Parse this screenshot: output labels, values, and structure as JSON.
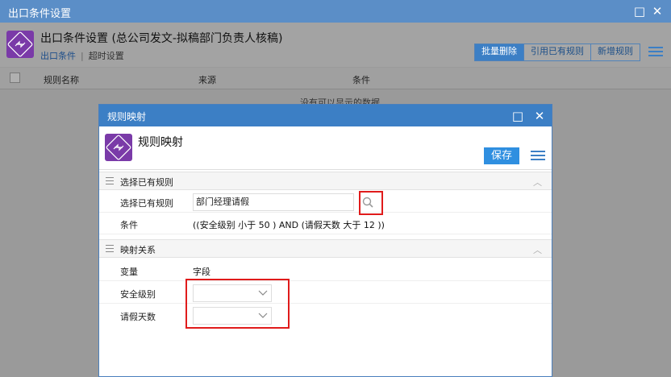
{
  "outer": {
    "title": "出口条件设置",
    "heading": "出口条件设置 (总公司发文-拟稿部门负责人核稿)",
    "tabs": [
      "出口条件",
      "超时设置"
    ],
    "buttons": [
      "批量删除",
      "引用已有规则",
      "新增规则"
    ],
    "columns": [
      "规则名称",
      "来源",
      "条件"
    ],
    "empty_text": "没有可以显示的数据",
    "icons": [
      "maximize-icon",
      "close-icon",
      "list-menu-icon",
      "flow-icon"
    ]
  },
  "dialog": {
    "title": "规则映射",
    "heading": "规则映射",
    "save_label": "保存",
    "section_existing": "选择已有规则",
    "select_rule_label": "选择已有规则",
    "select_rule_value": "部门经理请假",
    "condition_label": "条件",
    "condition_value": "((安全级别 小于 50 ) AND (请假天数 大于 12 ))",
    "section_mapping": "映射关系",
    "var_header": "变量",
    "field_header": "字段",
    "mapping_rows": [
      "安全级别",
      "请假天数"
    ]
  },
  "colors": {
    "titlebar": "#3c7fc5",
    "save_button": "#2f8fe0",
    "highlight": "#e01b1b",
    "app_icon": "#7a3aa8"
  }
}
